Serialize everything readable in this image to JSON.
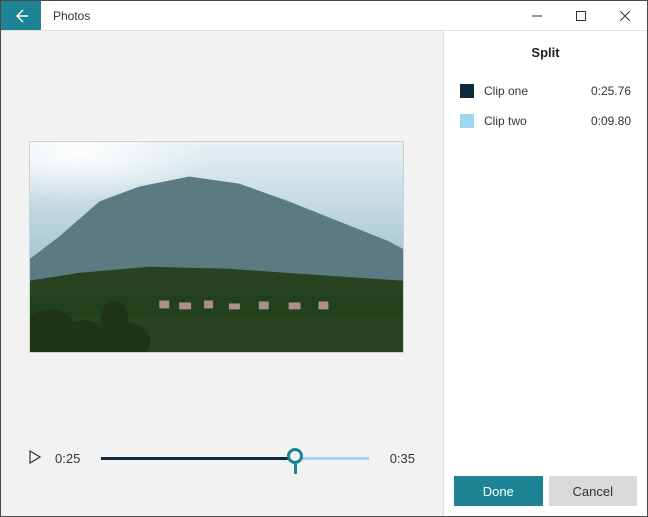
{
  "window": {
    "title": "Photos"
  },
  "panel": {
    "title": "Split",
    "clips": [
      {
        "name": "Clip one",
        "duration": "0:25.76",
        "color": "#0f2b3b"
      },
      {
        "name": "Clip two",
        "duration": "0:09.80",
        "color": "#9ed7ef"
      }
    ],
    "actions": {
      "done": "Done",
      "cancel": "Cancel"
    }
  },
  "player": {
    "position_label": "0:25",
    "total_label": "0:35",
    "split_fraction": 0.724,
    "accent": "#1c8494"
  }
}
